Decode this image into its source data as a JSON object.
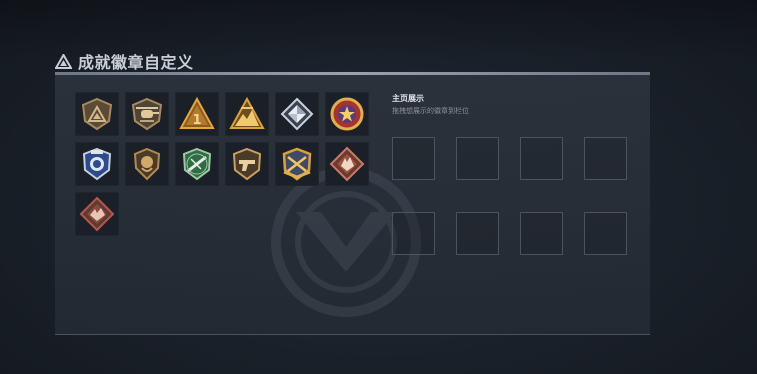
{
  "header": {
    "title": "成就徽章自定义",
    "icon": "warning-triangle-icon"
  },
  "showcase": {
    "title": "主页展示",
    "subtitle": "拖拽想展示的徽章到栏位",
    "slot_count": 8
  },
  "badges": [
    {
      "name": "triangle-shield-badge",
      "tier": "bronze"
    },
    {
      "name": "helicopter-badge",
      "tier": "bronze"
    },
    {
      "name": "number-one-triangle-badge",
      "tier": "gold"
    },
    {
      "name": "mountain-triangle-badge",
      "tier": "gold"
    },
    {
      "name": "diamond-crystal-badge",
      "tier": "silver"
    },
    {
      "name": "star-medal-badge",
      "tier": "purple-gold"
    },
    {
      "name": "blue-police-badge",
      "tier": "blue"
    },
    {
      "name": "lion-crest-badge",
      "tier": "bronze"
    },
    {
      "name": "green-rifle-badge",
      "tier": "green"
    },
    {
      "name": "pistol-crest-badge",
      "tier": "bronze"
    },
    {
      "name": "crossed-guns-gold-badge",
      "tier": "gold"
    },
    {
      "name": "wolf-diamond-badge",
      "tier": "red"
    },
    {
      "name": "wolf-diamond-badge-alt",
      "tier": "red"
    }
  ],
  "colors": {
    "background": "#1a2029",
    "panel": "#2c333d",
    "slot_border": "#4c535e",
    "bronze": "#a98a5e",
    "gold": "#d9a33a",
    "red": "#b4574a"
  }
}
